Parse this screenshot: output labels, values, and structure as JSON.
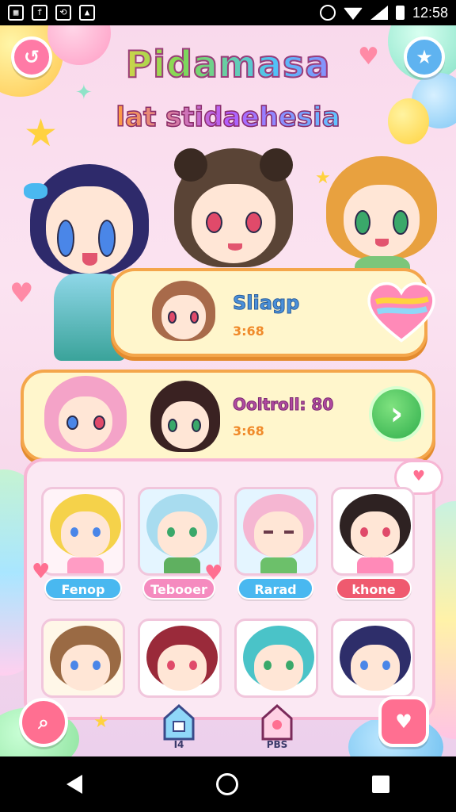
{
  "status_bar": {
    "time": "12:58",
    "notif_icons": [
      "photo-icon",
      "facebook-icon",
      "sync-icon",
      "image-icon"
    ]
  },
  "game": {
    "title": "Pidamasa",
    "subtitle": "lat stidaehesia",
    "featured": [
      {
        "name": "Sliagp",
        "score": "3:68"
      },
      {
        "name": "Ooltroll: 80",
        "score": "3:68"
      }
    ],
    "grid_tags": [
      {
        "label": "Fenop",
        "color": "#49b8f0"
      },
      {
        "label": "Tebooer",
        "color": "#f58bbf"
      },
      {
        "label": "Rarad",
        "color": "#49b8f0"
      },
      {
        "label": "khone",
        "color": "#ef5a6f"
      }
    ],
    "nav": [
      {
        "label": "I4"
      },
      {
        "label": "PBS"
      }
    ],
    "colors": {
      "accent_orange": "#f4a64b",
      "go_green": "#2fae4c",
      "pink_bg": "#fbe3f1"
    }
  }
}
